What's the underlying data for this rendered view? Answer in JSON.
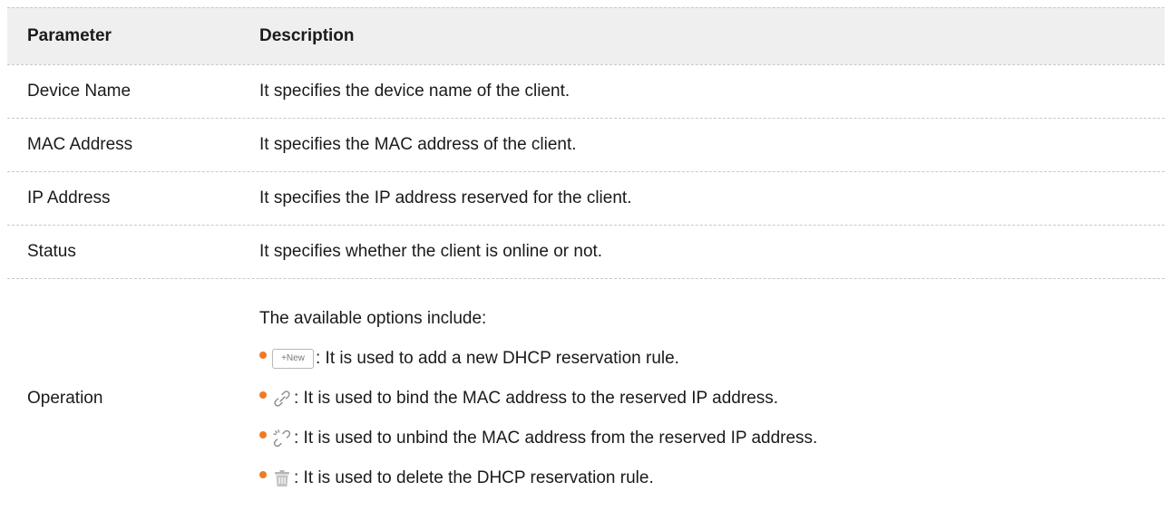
{
  "header": {
    "parameter": "Parameter",
    "description": "Description"
  },
  "rows": [
    {
      "parameter": "Device Name",
      "description": "It specifies the device name of the client."
    },
    {
      "parameter": "MAC Address",
      "description": "It specifies the MAC address of the client."
    },
    {
      "parameter": "IP Address",
      "description": "It specifies the IP address reserved for the client."
    },
    {
      "parameter": "Status",
      "description": "It specifies whether the client is online or not."
    }
  ],
  "operation": {
    "parameter": "Operation",
    "intro": "The available options include:",
    "new_button_label": "+New",
    "items": [
      {
        "icon": "new-button",
        "text": ": It is used to add a new DHCP reservation rule."
      },
      {
        "icon": "link-icon",
        "text": ": It is used to bind the MAC address to the reserved IP address."
      },
      {
        "icon": "unlink-icon",
        "text": ": It is used to unbind the MAC address from the reserved IP address."
      },
      {
        "icon": "trash-icon",
        "text": ": It is used to delete the DHCP reservation rule."
      }
    ]
  },
  "colors": {
    "bullet": "#f07a22",
    "header_bg": "#efefef",
    "border": "#c8c8c8"
  }
}
